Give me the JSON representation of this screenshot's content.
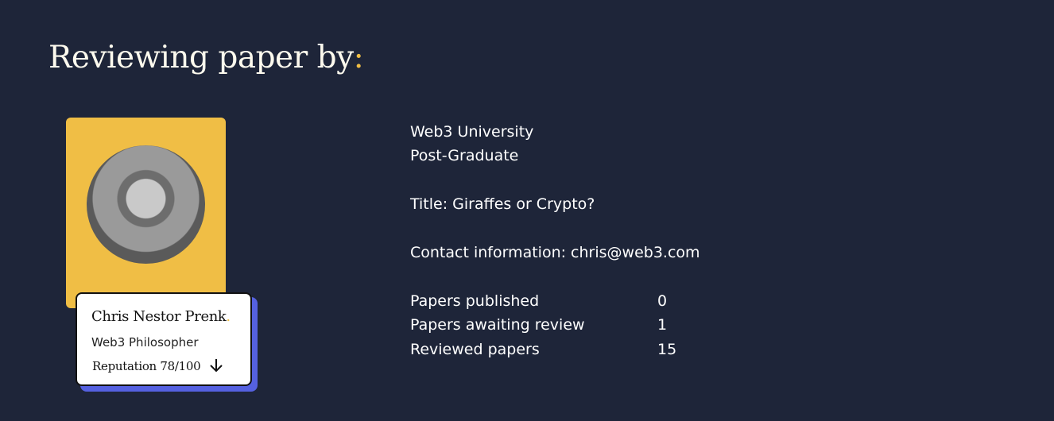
{
  "header": {
    "title": "Reviewing paper by",
    "title_suffix": ":"
  },
  "profile": {
    "name": "Chris Nestor Prenk",
    "name_suffix": ".",
    "role": "Web3 Philosopher",
    "reputation": "Reputation 78/100",
    "reputation_icon": "arrow-down-icon"
  },
  "details": {
    "university": "Web3 University",
    "level": "Post-Graduate",
    "title": "Title: Giraffes or Crypto?",
    "contact": "Contact information: chris@web3.com"
  },
  "stats": [
    {
      "label": "Papers published",
      "value": "0"
    },
    {
      "label": "Papers awaiting review",
      "value": "1"
    },
    {
      "label": "Reviewed papers",
      "value": "15"
    }
  ],
  "colors": {
    "background": "#1e2539",
    "accent": "#f0be45",
    "card_shadow": "#5561e0"
  }
}
